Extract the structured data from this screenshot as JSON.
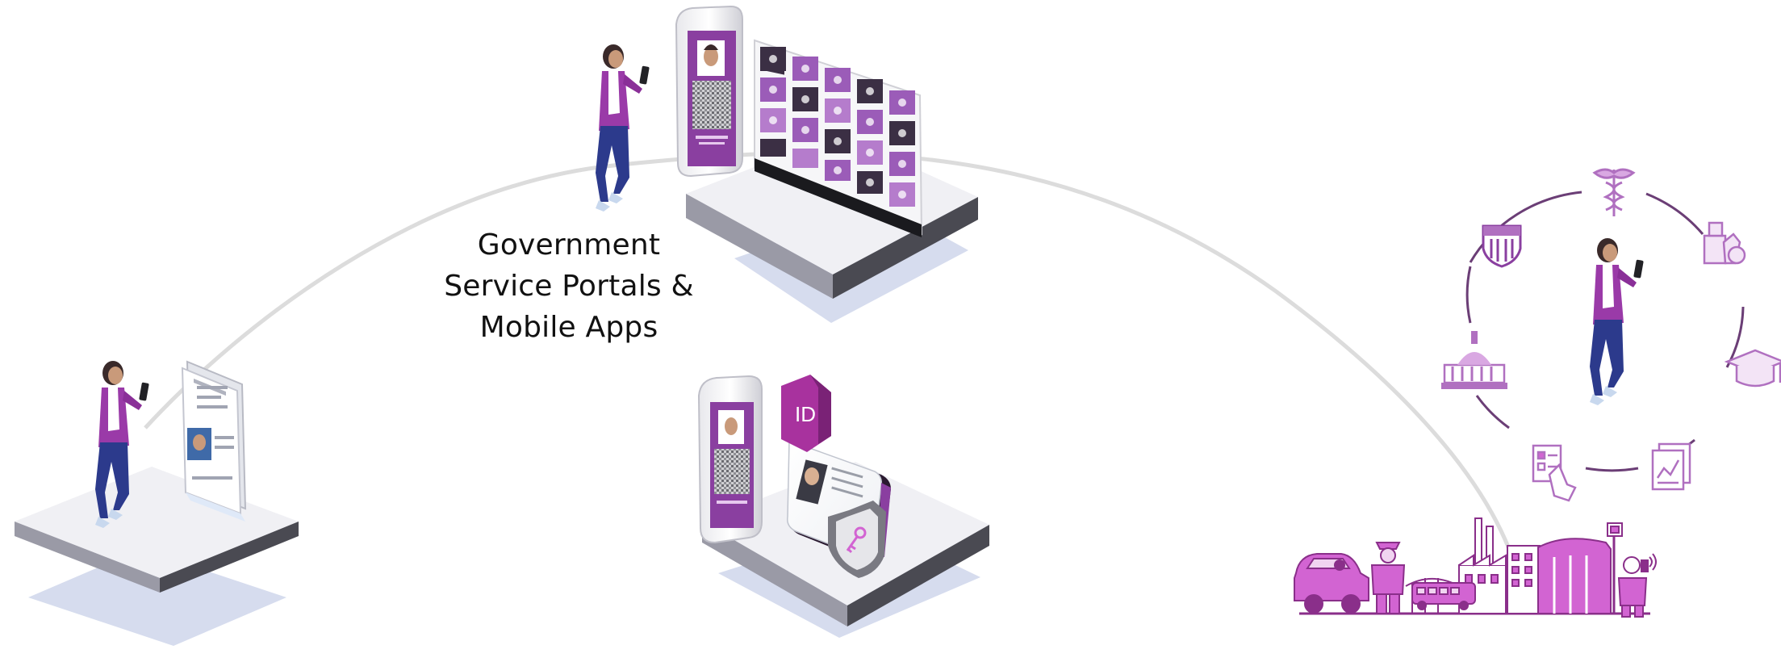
{
  "caption": {
    "lines": [
      "Government",
      "Service Portals &",
      "Mobile Apps"
    ]
  },
  "id_badge": {
    "text": "ID"
  },
  "colors": {
    "purple": "#8a3fa0",
    "purple_light": "#c98ad6",
    "purple_pale": "#d7a4de",
    "pink_magenta": "#d264d2",
    "platform_top": "#f0f0f4",
    "platform_side": "#4a4a52",
    "shadow_blue": "#d6dcee",
    "arc_gray": "#dcdcdc",
    "jeans_blue": "#2c3a8c",
    "ring_purple": "#6b3e76"
  },
  "icons": {
    "ring": [
      "shield-stars-icon",
      "caduceus-icon",
      "education-tools-icon",
      "graduation-cap-icon",
      "report-documents-icon",
      "checklist-hand-icon",
      "capitol-building-icon"
    ],
    "city": [
      "car-icon",
      "police-officer-icon",
      "factory-icon",
      "bus-icon",
      "office-building-icon",
      "bus-stop-icon",
      "person-with-phone-icon"
    ]
  }
}
